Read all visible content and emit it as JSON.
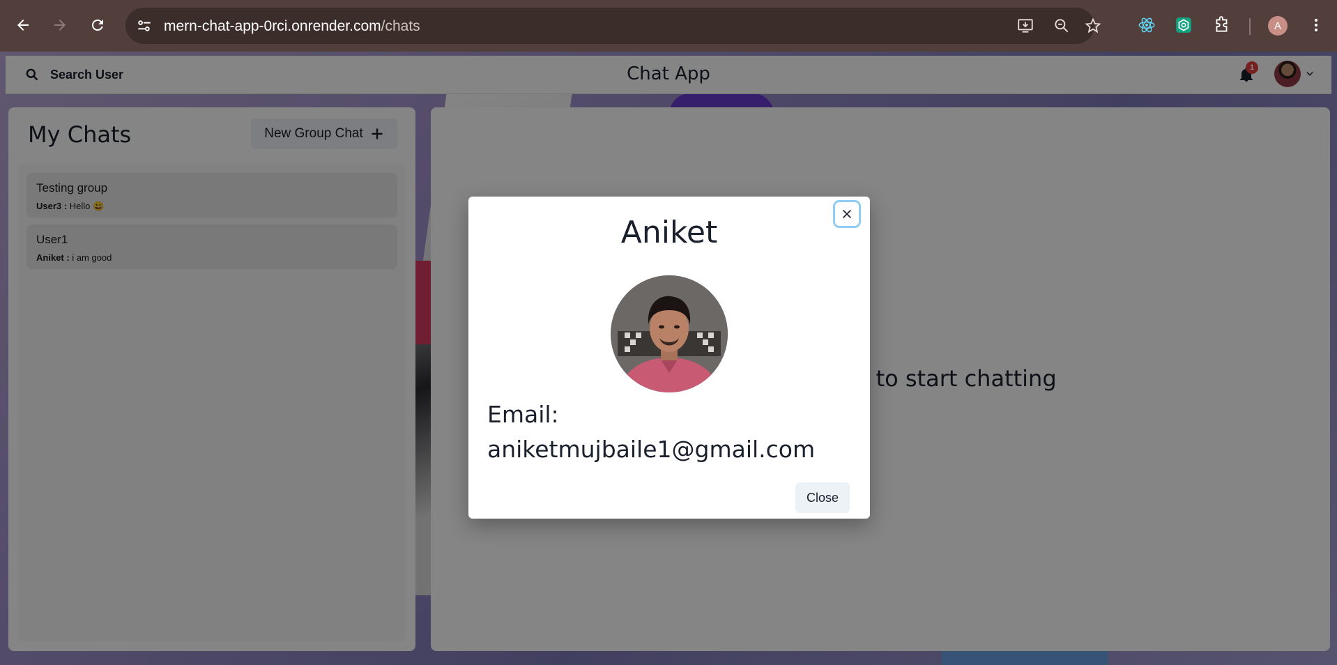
{
  "browser": {
    "url_host": "mern-chat-app-0rci.onrender.com",
    "url_path": "/chats",
    "profile_initial": "A"
  },
  "topbar": {
    "search_label": "Search User",
    "app_title": "Chat App",
    "notification_count": "1"
  },
  "sidebar": {
    "title": "My Chats",
    "new_group_label": "New Group Chat",
    "chats": [
      {
        "name": "Testing group",
        "sender": "User3 :",
        "message": "Hello 😀"
      },
      {
        "name": "User1",
        "sender": "Aniket :",
        "message": "i am good"
      }
    ]
  },
  "main": {
    "hint": "Click on a user to start chatting"
  },
  "modal": {
    "title": "Aniket",
    "email_label": "Email:",
    "email_value": "aniketmujbaile1@gmail.com",
    "close_label": "Close"
  }
}
